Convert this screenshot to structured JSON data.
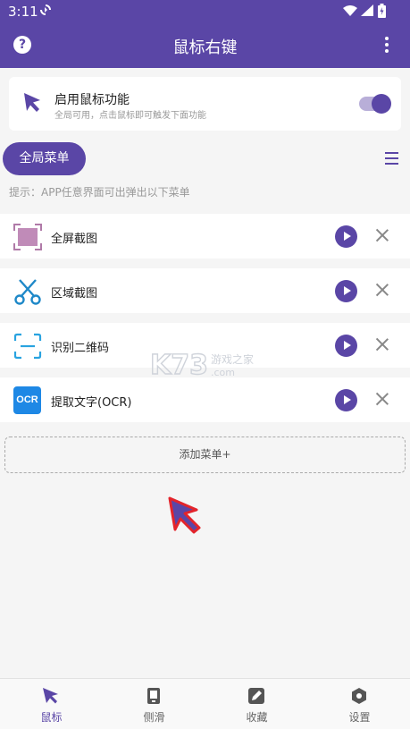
{
  "status_bar": {
    "time": "3:11"
  },
  "header": {
    "title": "鼠标右键"
  },
  "enable_card": {
    "title": "启用鼠标功能",
    "subtitle": "全局可用，点击鼠标即可触发下面功能",
    "enabled": true
  },
  "menu_chip": {
    "label": "全局菜单"
  },
  "hint": "提示：APP任意界面可出弹出以下菜单",
  "menu_items": [
    {
      "label": "全屏截图",
      "icon": "fullscreen-screenshot-icon"
    },
    {
      "label": "区域截图",
      "icon": "scissors-icon"
    },
    {
      "label": "识别二维码",
      "icon": "qr-scan-icon"
    },
    {
      "label": "提取文字(OCR)",
      "icon": "ocr-icon",
      "badge": "OCR"
    }
  ],
  "add_button": {
    "label": "添加菜单+"
  },
  "watermark": {
    "text": "K73",
    "sub": "游戏之家",
    "domain": ".com"
  },
  "bottom_nav": [
    {
      "label": "鼠标",
      "icon": "mouse-cursor-icon",
      "active": true
    },
    {
      "label": "侧滑",
      "icon": "side-swipe-icon",
      "active": false
    },
    {
      "label": "收藏",
      "icon": "favorite-edit-icon",
      "active": false
    },
    {
      "label": "设置",
      "icon": "settings-hex-icon",
      "active": false
    }
  ],
  "colors": {
    "primary": "#5a46a6",
    "toggle_track": "#b8aed8",
    "ocr_blue": "#1e88e5",
    "scan_blue": "#29a3e0"
  }
}
